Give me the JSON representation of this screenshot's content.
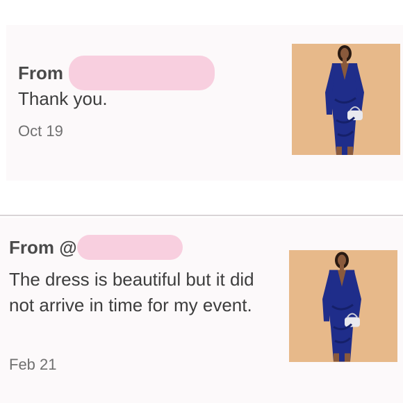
{
  "messages": [
    {
      "from_label": "From",
      "sender_handle_prefix": "",
      "text": "Thank you.",
      "date": "Oct 19",
      "image": "product-photo-blue-velvet-dress"
    },
    {
      "from_label": "From @",
      "sender_handle_prefix": "",
      "text": "The dress is beautiful but it did not arrive in time for my event.",
      "date": "Feb 21",
      "image": "product-photo-blue-velvet-dress"
    }
  ],
  "colors": {
    "card_bg": "#fcf9fa",
    "redaction": "#f8cfdf",
    "photo_bg": "#e7b98a",
    "dress": "#1f2d8a"
  }
}
